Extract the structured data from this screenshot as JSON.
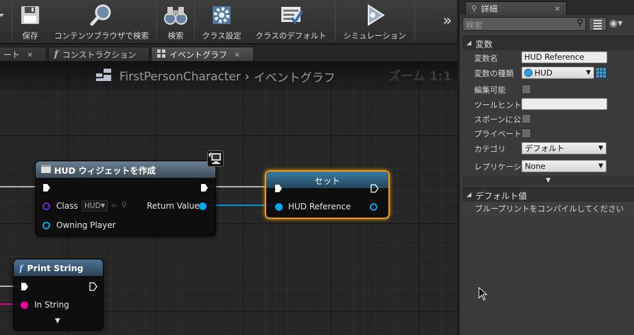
{
  "toolbar": {
    "save": "保存",
    "content_browser_search": "コンテンツブラウザで検索",
    "search": "検索",
    "class_settings": "クラス設定",
    "class_defaults": "クラスのデフォルト",
    "simulation": "シミュレーション",
    "more": "»"
  },
  "tabs": {
    "first": "ート",
    "construction": "コンストラクション",
    "event_graph": "イベントグラフ",
    "close": "×"
  },
  "graph": {
    "breadcrumb_blueprint": "FirstPersonCharacter",
    "breadcrumb_sep": "›",
    "breadcrumb_graph": "イベントグラフ",
    "zoom": "ズーム 1:1"
  },
  "nodes": {
    "create_widget": {
      "title": "HUD ウィジェットを作成",
      "class_label": "Class",
      "class_value": "HUD",
      "return_label": "Return Value",
      "owning_player_label": "Owning Player"
    },
    "set": {
      "title": "セット",
      "hud_reference_label": "HUD Reference"
    },
    "print_string": {
      "title": "Print String",
      "in_string_label": "In String"
    }
  },
  "details": {
    "tab_title": "詳細",
    "search_placeholder": "検索",
    "variable_category": "変数",
    "rows": {
      "var_name_label": "変数名",
      "var_name_value": "HUD Reference",
      "var_type_label": "変数の種類",
      "var_type_value": "HUD",
      "editable_label": "編集可能",
      "tooltip_label": "ツールヒント",
      "spawn_label": "スポーンに公",
      "private_label": "プライベート",
      "category_label": "カテゴリ",
      "category_value": "デフォルト",
      "replication_label": "レプリケーシ",
      "replication_value": "None"
    },
    "default_category": "デフォルト値",
    "compile_note": "ブループリントをコンパイルしてください"
  },
  "colors": {
    "exec_wire": "#ffffff",
    "object_wire": "#00a8f0",
    "string_wire": "#f000a0",
    "class_pin": "#5b00b6",
    "selection": "#f39c12",
    "widget_header": "#4a6072",
    "set_header": "#2e5f7f",
    "function_header": "#3a5a78"
  }
}
